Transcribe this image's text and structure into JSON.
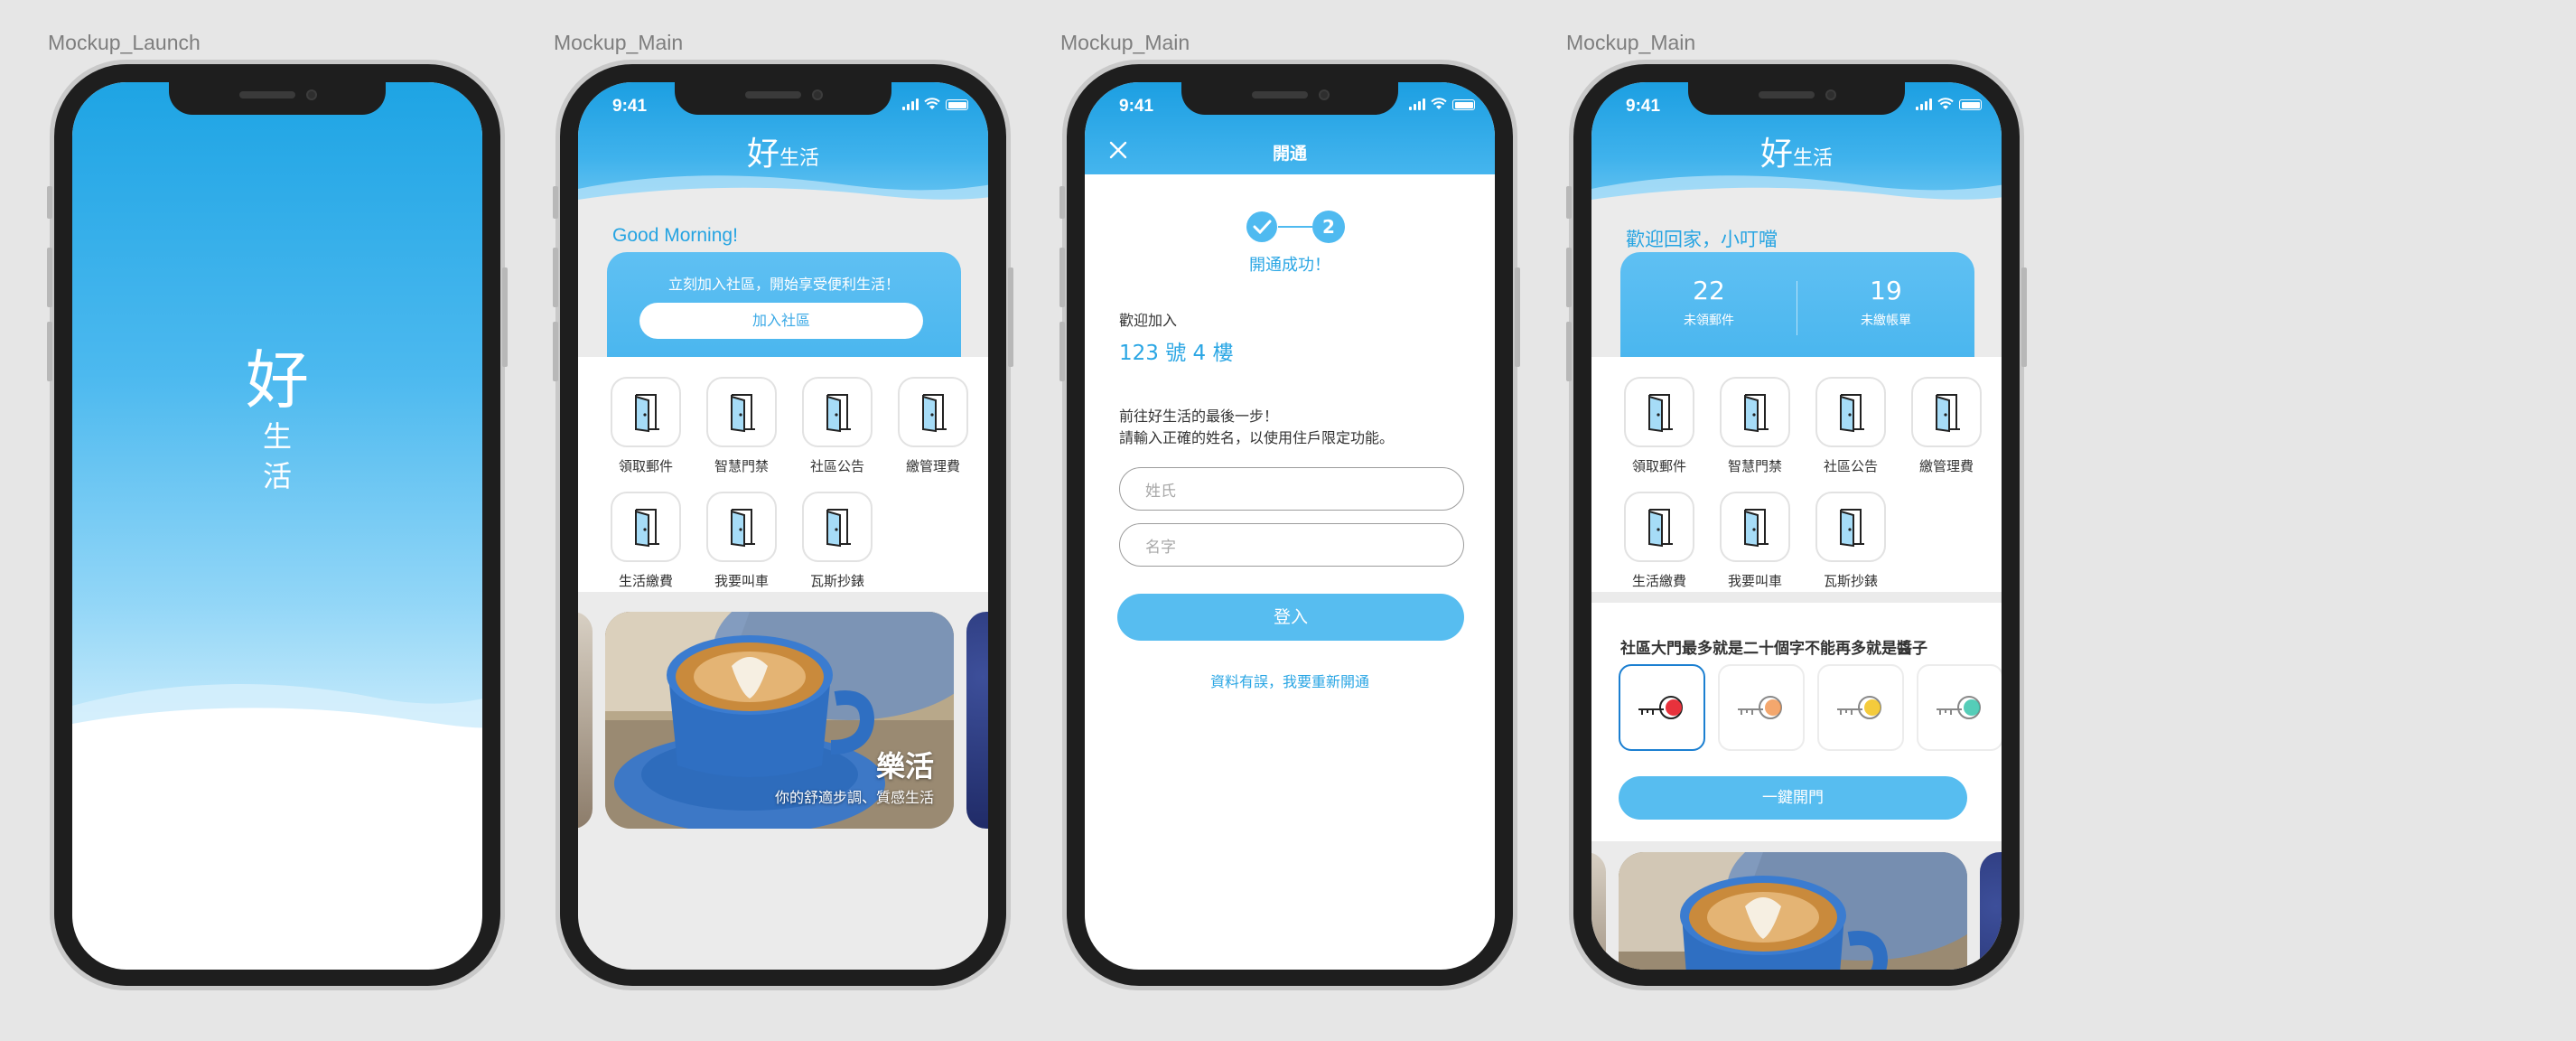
{
  "frames": [
    {
      "label": "Mockup_Launch"
    },
    {
      "label": "Mockup_Main"
    },
    {
      "label": "Mockup_Main"
    },
    {
      "label": "Mockup_Main"
    }
  ],
  "status": {
    "time": "9:41"
  },
  "launch": {
    "logo_main": "好",
    "logo_sub1": "生",
    "logo_sub2": "活"
  },
  "app_logo": {
    "main": "好",
    "sub": "生活"
  },
  "home_guest": {
    "greeting": "Good Morning!",
    "join_prompt": "立刻加入社區，開始享受便利生活！",
    "join_button": "加入社區"
  },
  "features": [
    {
      "label": "領取郵件",
      "icon": "door-icon"
    },
    {
      "label": "智慧門禁",
      "icon": "door-icon"
    },
    {
      "label": "社區公告",
      "icon": "door-icon"
    },
    {
      "label": "繳管理費",
      "icon": "door-icon"
    },
    {
      "label": "生活繳費",
      "icon": "door-icon"
    },
    {
      "label": "我要叫車",
      "icon": "door-icon"
    },
    {
      "label": "瓦斯抄錶",
      "icon": "door-icon"
    }
  ],
  "banner": {
    "title": "樂活",
    "subtitle": "你的舒適步調、質感生活"
  },
  "activation": {
    "title": "開通",
    "step2": "2",
    "success": "開通成功！",
    "welcome_label": "歡迎加入",
    "address": "123 號 4 樓",
    "instruction_1": "前往好生活的最後一步！",
    "instruction_2": "請輸入正確的姓名，以使用住戶限定功能。",
    "lastname_placeholder": "姓氏",
    "firstname_placeholder": "名字",
    "login_button": "登入",
    "reactivate_link": "資料有誤，我要重新開通"
  },
  "home_member": {
    "greeting": "歡迎回家，小叮噹",
    "stats": [
      {
        "value": "22",
        "label": "未領郵件"
      },
      {
        "value": "19",
        "label": "未繳帳單"
      }
    ],
    "gate_title": "社區大門最多就是二十個字不能再多就是醬子",
    "keys": [
      {
        "color": "#e8323c"
      },
      {
        "color": "#f08a3c"
      },
      {
        "color": "#f2c21a"
      },
      {
        "color": "#2bc0a6"
      }
    ],
    "open_button": "一鍵開門"
  }
}
